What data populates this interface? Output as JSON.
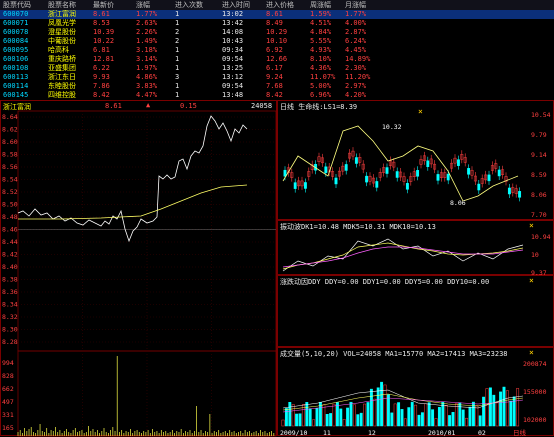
{
  "top_table": {
    "columns": [
      "股票代码",
      "股票名称",
      "最新价",
      "涨幅",
      "进入次数",
      "进入时间",
      "进入价格",
      "周涨幅",
      "月涨幅"
    ],
    "rows": [
      {
        "code": "600070",
        "name": "浙江富润",
        "latest": "8.61",
        "change": "1.77%",
        "count": "1",
        "time": "13:02",
        "price": "8.61",
        "week": "1.59%",
        "month": "1.77%",
        "selected": true
      },
      {
        "code": "600071",
        "name": "凤凰光学",
        "latest": "8.53",
        "change": "2.63%",
        "count": "1",
        "time": "13:42",
        "price": "8.49",
        "week": "4.51%",
        "month": "4.00%"
      },
      {
        "code": "600078",
        "name": "澄星股份",
        "latest": "10.39",
        "change": "2.26%",
        "count": "2",
        "time": "14:08",
        "price": "10.29",
        "week": "4.84%",
        "month": "2.87%"
      },
      {
        "code": "600084",
        "name": "中葡股份",
        "latest": "10.22",
        "change": "1.49%",
        "count": "2",
        "time": "10:43",
        "price": "10.10",
        "week": "5.55%",
        "month": "6.24%"
      },
      {
        "code": "600095",
        "name": "哈高科",
        "latest": "6.81",
        "change": "3.18%",
        "count": "1",
        "time": "09:34",
        "price": "6.92",
        "week": "4.93%",
        "month": "4.45%"
      },
      {
        "code": "600106",
        "name": "重庆路桥",
        "latest": "12.81",
        "change": "3.14%",
        "count": "1",
        "time": "09:54",
        "price": "12.66",
        "week": "8.10%",
        "month": "14.89%"
      },
      {
        "code": "600108",
        "name": "亚盛集团",
        "latest": "6.22",
        "change": "1.97%",
        "count": "1",
        "time": "13:25",
        "price": "6.17",
        "week": "4.36%",
        "month": "2.30%"
      },
      {
        "code": "600113",
        "name": "浙江东日",
        "latest": "9.93",
        "change": "4.86%",
        "count": "3",
        "time": "13:12",
        "price": "9.24",
        "week": "11.07%",
        "month": "11.20%"
      },
      {
        "code": "600114",
        "name": "东睦股份",
        "latest": "7.86",
        "change": "3.83%",
        "count": "1",
        "time": "09:54",
        "price": "7.68",
        "week": "5.00%",
        "month": "2.97%"
      },
      {
        "code": "600145",
        "name": "四维控股",
        "latest": "8.42",
        "change": "4.47%",
        "count": "1",
        "time": "13:48",
        "price": "8.42",
        "week": "6.96%",
        "month": "4.20%"
      }
    ]
  },
  "intraday": {
    "stock_name": "浙江富润",
    "price": "8.61",
    "change": "0.15",
    "volume": "24058",
    "price_axis": [
      "8.64",
      "8.62",
      "8.60",
      "8.58",
      "8.56",
      "8.54",
      "8.52",
      "8.50",
      "8.48",
      "8.46",
      "8.44",
      "8.42",
      "8.40",
      "8.38",
      "8.36",
      "8.34",
      "8.32",
      "8.30",
      "8.28"
    ],
    "volume_axis": [
      "994",
      "828",
      "662",
      "497",
      "331",
      "165"
    ],
    "pct_axis": [
      "0.12%",
      "0.09%",
      "0.06%",
      "0.03%",
      "0.00%",
      "0.03%",
      "0.06%",
      "0.09%",
      "0.12%"
    ]
  },
  "kline": {
    "title": "日线 生命线:LS1=8.39",
    "high_label": "10.32",
    "low_label": "8.06",
    "price_axis": [
      "10.54",
      "9.79",
      "9.14",
      "8.59",
      "8.06",
      "7.70"
    ]
  },
  "indicator1": {
    "title": "振动波DK1=10.48 MDK5=10.31 MDK10=10.13",
    "axis": [
      "10.94",
      "10",
      "9.37"
    ]
  },
  "indicator2": {
    "title": "涨跌动因DDY DDY=0.00 DDY1=0.00 DDY5=0.00 DDY10=0.00"
  },
  "volume_panel": {
    "title": "成交量(5,10,20) VOL=24058 MA1=15770 MA2=17413 MA3=23238",
    "axis": [
      "200874",
      "155000",
      "102000"
    ],
    "dates": [
      "2009/10",
      "11",
      "12",
      "2010/01",
      "02"
    ],
    "period": "日线"
  },
  "colors": {
    "red": "#ff4040",
    "yellow": "#ffff00",
    "cyan": "#00d7ff",
    "panel_border": "#7a0000"
  }
}
